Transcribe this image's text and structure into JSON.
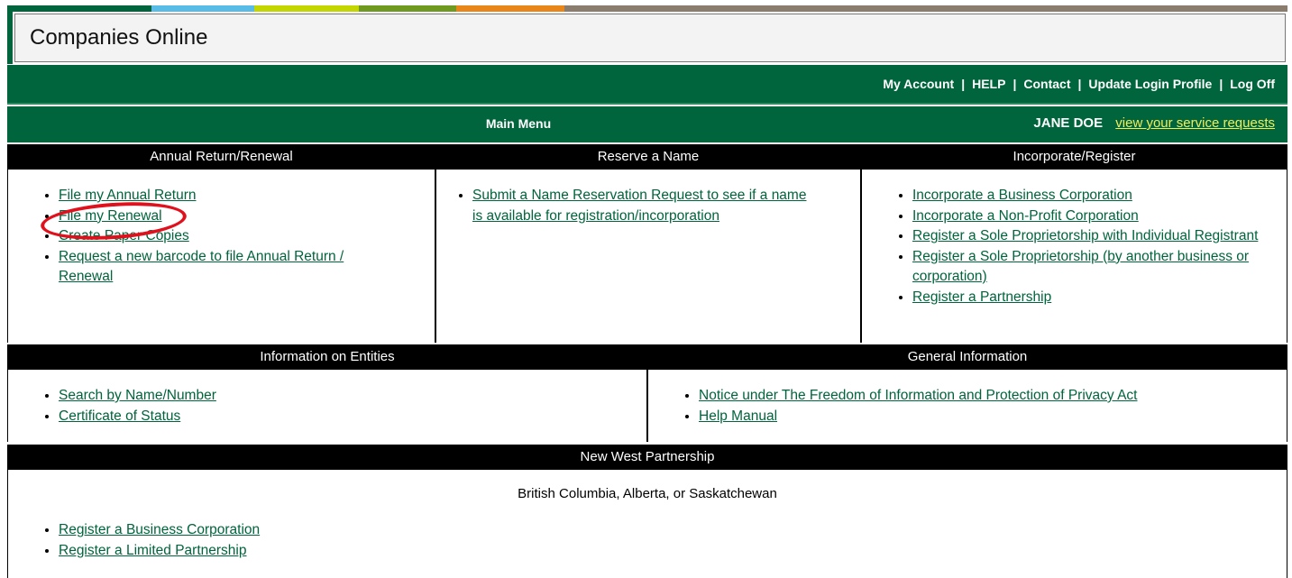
{
  "strip_colors": [
    "#00643c",
    "#58bce6",
    "#c4d600",
    "#6e9a1f",
    "#e8861a",
    "#8a7d6e"
  ],
  "app_title": "Companies Online",
  "account_links": [
    "My Account",
    "HELP",
    "Contact",
    "Update Login Profile",
    "Log Off"
  ],
  "account_separator": "|",
  "menu": {
    "title": "Main Menu",
    "user_name": "JANE DOE",
    "service_requests_link": "view your service requests"
  },
  "annual": {
    "header": "Annual Return/Renewal",
    "items": [
      "File my Annual Return",
      "File my Renewal",
      "Create Paper Copies",
      "Request a new barcode to file Annual Return / Renewal"
    ]
  },
  "reserve": {
    "header": "Reserve a Name",
    "items": [
      "Submit a Name Reservation Request to see if a name is available for registration/incorporation"
    ]
  },
  "incorporate": {
    "header": "Incorporate/Register",
    "items": [
      "Incorporate a Business Corporation",
      "Incorporate a Non-Profit Corporation",
      "Register a Sole Proprietorship with Individual Registrant",
      "Register a Sole Proprietorship (by another business or corporation)",
      "Register a Partnership"
    ]
  },
  "entities": {
    "header": "Information on Entities",
    "items": [
      "Search by Name/Number",
      "Certificate of Status"
    ]
  },
  "general": {
    "header": "General Information",
    "items": [
      "Notice under The Freedom of Information and Protection of Privacy Act",
      "Help Manual"
    ]
  },
  "nwp": {
    "header": "New West Partnership",
    "provinces": "British Columbia, Alberta, or Saskatchewan",
    "items": [
      "Register a Business Corporation",
      "Register a Limited Partnership"
    ]
  },
  "colors": {
    "green": "#00643c",
    "link": "#00643c",
    "user_link": "#f3ee58",
    "annotation": "#e0101c"
  }
}
